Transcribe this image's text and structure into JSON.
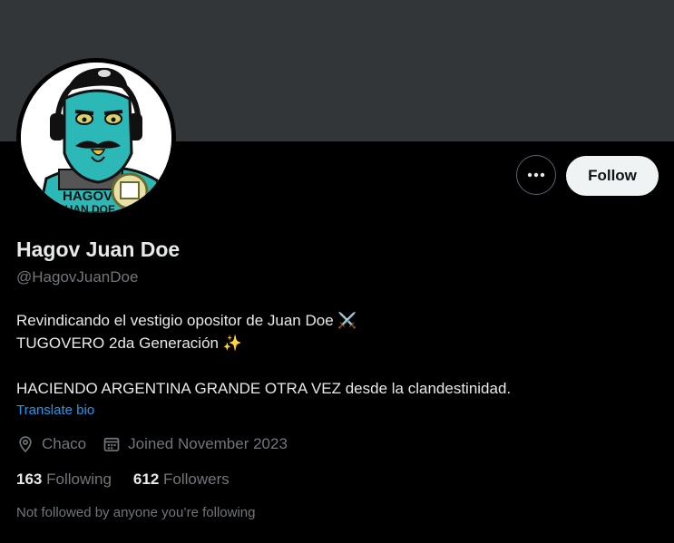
{
  "profile": {
    "name": "Hagov Juan Doe",
    "handle": "@HagovJuanDoe",
    "follow_label": "Follow",
    "bio_lines": [
      "Revindicando el vestigio opositor de Juan Doe ⚔️",
      "TUGOVERO 2da Generación ✨",
      "",
      "HACIENDO ARGENTINA GRANDE OTRA VEZ desde la clandestinidad."
    ],
    "translate_label": "Translate bio",
    "location": "Chaco",
    "joined": "Joined November 2023",
    "following_count": "163",
    "following_label": "Following",
    "followers_count": "612",
    "followers_label": "Followers",
    "not_followed_text": "Not followed by anyone you’re following"
  },
  "avatar": {
    "shirt_text_line1": "HAGOV",
    "shirt_text_line2": "JUAN DOE"
  },
  "colors": {
    "background": "#000000",
    "banner": "#333639",
    "link": "#1d9bf0",
    "muted": "#71767b",
    "text": "#e7e9ea",
    "avatar_face": "#2bb8b6"
  }
}
